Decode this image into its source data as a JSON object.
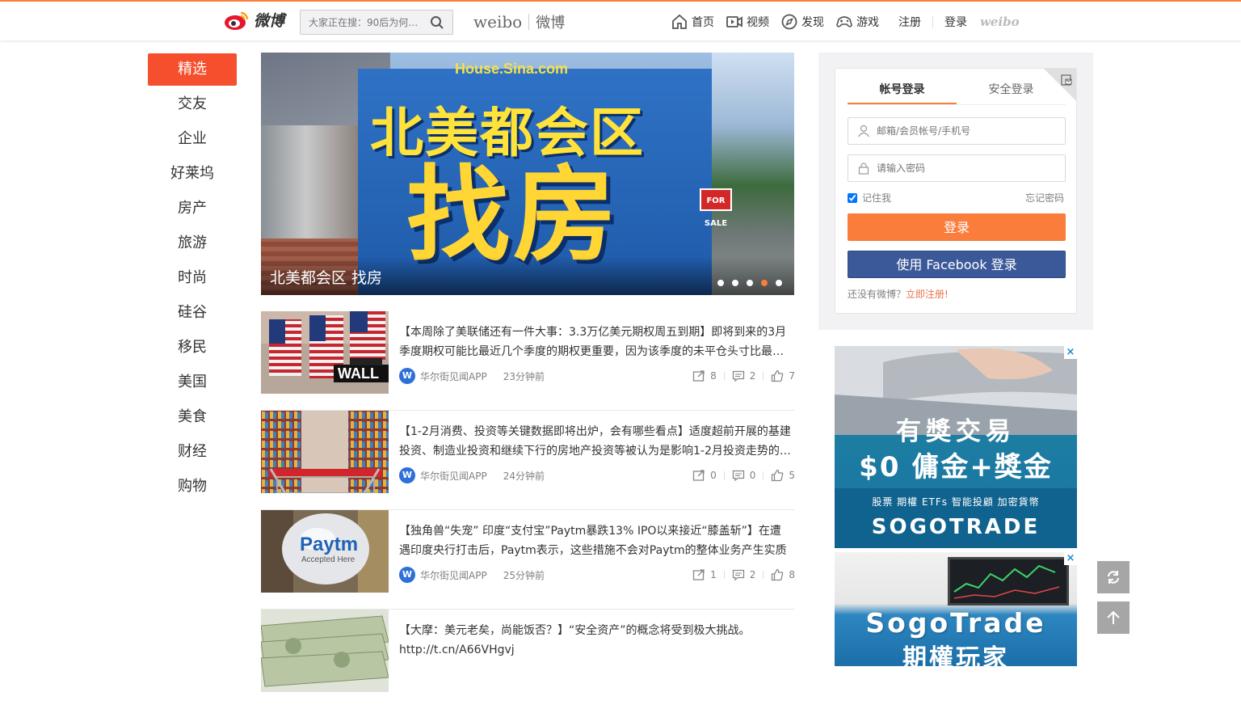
{
  "header": {
    "logo_text": "微博",
    "search_placeholder": "大家正在搜：90后为何…",
    "brand_en": "weibo",
    "brand_cn": "微博",
    "nav": [
      {
        "label": "首页",
        "icon": "home-icon"
      },
      {
        "label": "视频",
        "icon": "video-icon"
      },
      {
        "label": "发现",
        "icon": "discover-icon"
      },
      {
        "label": "游戏",
        "icon": "game-icon"
      }
    ],
    "register": "注册",
    "login": "登录",
    "weibo_small": "weibo"
  },
  "sidebar": {
    "items": [
      {
        "label": "精选",
        "active": true
      },
      {
        "label": "交友"
      },
      {
        "label": "企业"
      },
      {
        "label": "好莱坞"
      },
      {
        "label": "房产"
      },
      {
        "label": "旅游"
      },
      {
        "label": "时尚"
      },
      {
        "label": "硅谷"
      },
      {
        "label": "移民"
      },
      {
        "label": "美国"
      },
      {
        "label": "美食"
      },
      {
        "label": "财经"
      },
      {
        "label": "购物"
      }
    ]
  },
  "banner": {
    "site": "House.Sina.com",
    "headline_line1": "北美都会区",
    "headline_line2": "找房",
    "sign": "FOR SALE",
    "caption": "北美都会区 找房",
    "slide_count": 5,
    "active_slide": 4
  },
  "feed": [
    {
      "text": "【本周除了美联储还有一件大事：3.3万亿美元期权周五到期】即将到来的3月季度期权可能比最近几个季度的期权更重要，因为该季度的未平仓头寸比最…",
      "source": "华尔街见闻APP",
      "time": "23分钟前",
      "reposts": "8",
      "comments": "2",
      "likes": "7",
      "thumb": "wall-street-flags"
    },
    {
      "text": "【1-2月消费、投资等关键数据即将出炉，会有哪些看点】适度超前开展的基建投资、制造业投资和继续下行的房地产投资等被认为是影响1-2月投资走势的…",
      "source": "华尔街见闻APP",
      "time": "24分钟前",
      "reposts": "0",
      "comments": "0",
      "likes": "5",
      "thumb": "supermarket-cart"
    },
    {
      "text": "【独角兽“失宠” 印度“支付宝”Paytm暴跌13% IPO以来接近“膝盖斩”】在遭遇印度央行打击后，Paytm表示，这些措施不会对Paytm的整体业务产生实质性的…",
      "source": "华尔街见闻APP",
      "time": "25分钟前",
      "reposts": "1",
      "comments": "2",
      "likes": "8",
      "thumb": "paytm-balloon",
      "thumb_text": "Paytm",
      "thumb_sub": "Accepted Here"
    },
    {
      "text": "【大摩：美元老矣，尚能饭否？】“安全资产”的概念将受到极大挑战。http://t.cn/A66VHgvj",
      "thumb": "dollar-bills"
    }
  ],
  "login": {
    "tab_account": "帐号登录",
    "tab_secure": "安全登录",
    "username_placeholder": "邮箱/会员帐号/手机号",
    "password_placeholder": "请输入密码",
    "remember": "记住我",
    "forgot": "忘记密码",
    "login_button": "登录",
    "facebook_button": "使用 Facebook 登录",
    "no_account": "还没有微博？",
    "register_link": "立即注册!"
  },
  "ads": {
    "ad1_line1": "有獎交易",
    "ad1_line2": "$0 傭金+獎金",
    "ad1_row": "股票   期權   ETFs   智能投顧   加密貨幣",
    "ad1_brand": "SOGOTRADE",
    "ad2_line1": "SogoTrade",
    "ad2_line2": "期權玩家",
    "close": "×"
  },
  "colors": {
    "accent": "#fa7d3c",
    "active_nav": "#f54f2e",
    "facebook": "#3b5998",
    "float_button": "#a6a6a6"
  }
}
